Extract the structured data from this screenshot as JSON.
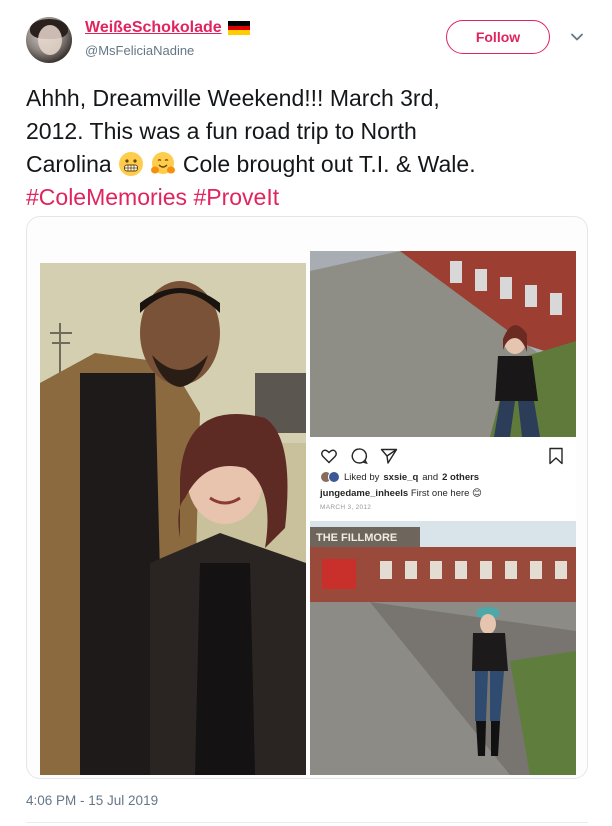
{
  "tweet": {
    "display_name": "WeißeSchokolade",
    "handle": "@MsFeliciaNadine",
    "follow_label": "Follow",
    "text_line1": "Ahhh, Dreamville Weekend!!! March 3rd,",
    "text_line2": "2012. This was a fun road trip to North",
    "text_line3_a": "Carolina",
    "text_line3_b": "Cole brought out T.I. & Wale.",
    "hashtag1": "#ColeMemories",
    "hashtag2": "#ProveIt",
    "timestamp": "4:06 PM - 15 Jul 2019"
  },
  "icons": {
    "flag": "germany-flag-icon",
    "emoji1": "grimacing-face-emoji",
    "emoji2": "hugging-face-emoji",
    "chevron": "chevron-down-icon"
  },
  "instagram": {
    "liked_by_prefix": "Liked by",
    "liked_by_user": "sxsie_q",
    "liked_by_and": "and",
    "liked_by_others": "2 others",
    "caption_user": "jungedame_inheels",
    "caption_text": "First one here 😊",
    "date": "MARCH 3, 2012",
    "sign_text": "THE FILLMORE"
  },
  "colors": {
    "accent": "#e0245e",
    "secondary_text": "#657786",
    "text": "#14171a"
  }
}
